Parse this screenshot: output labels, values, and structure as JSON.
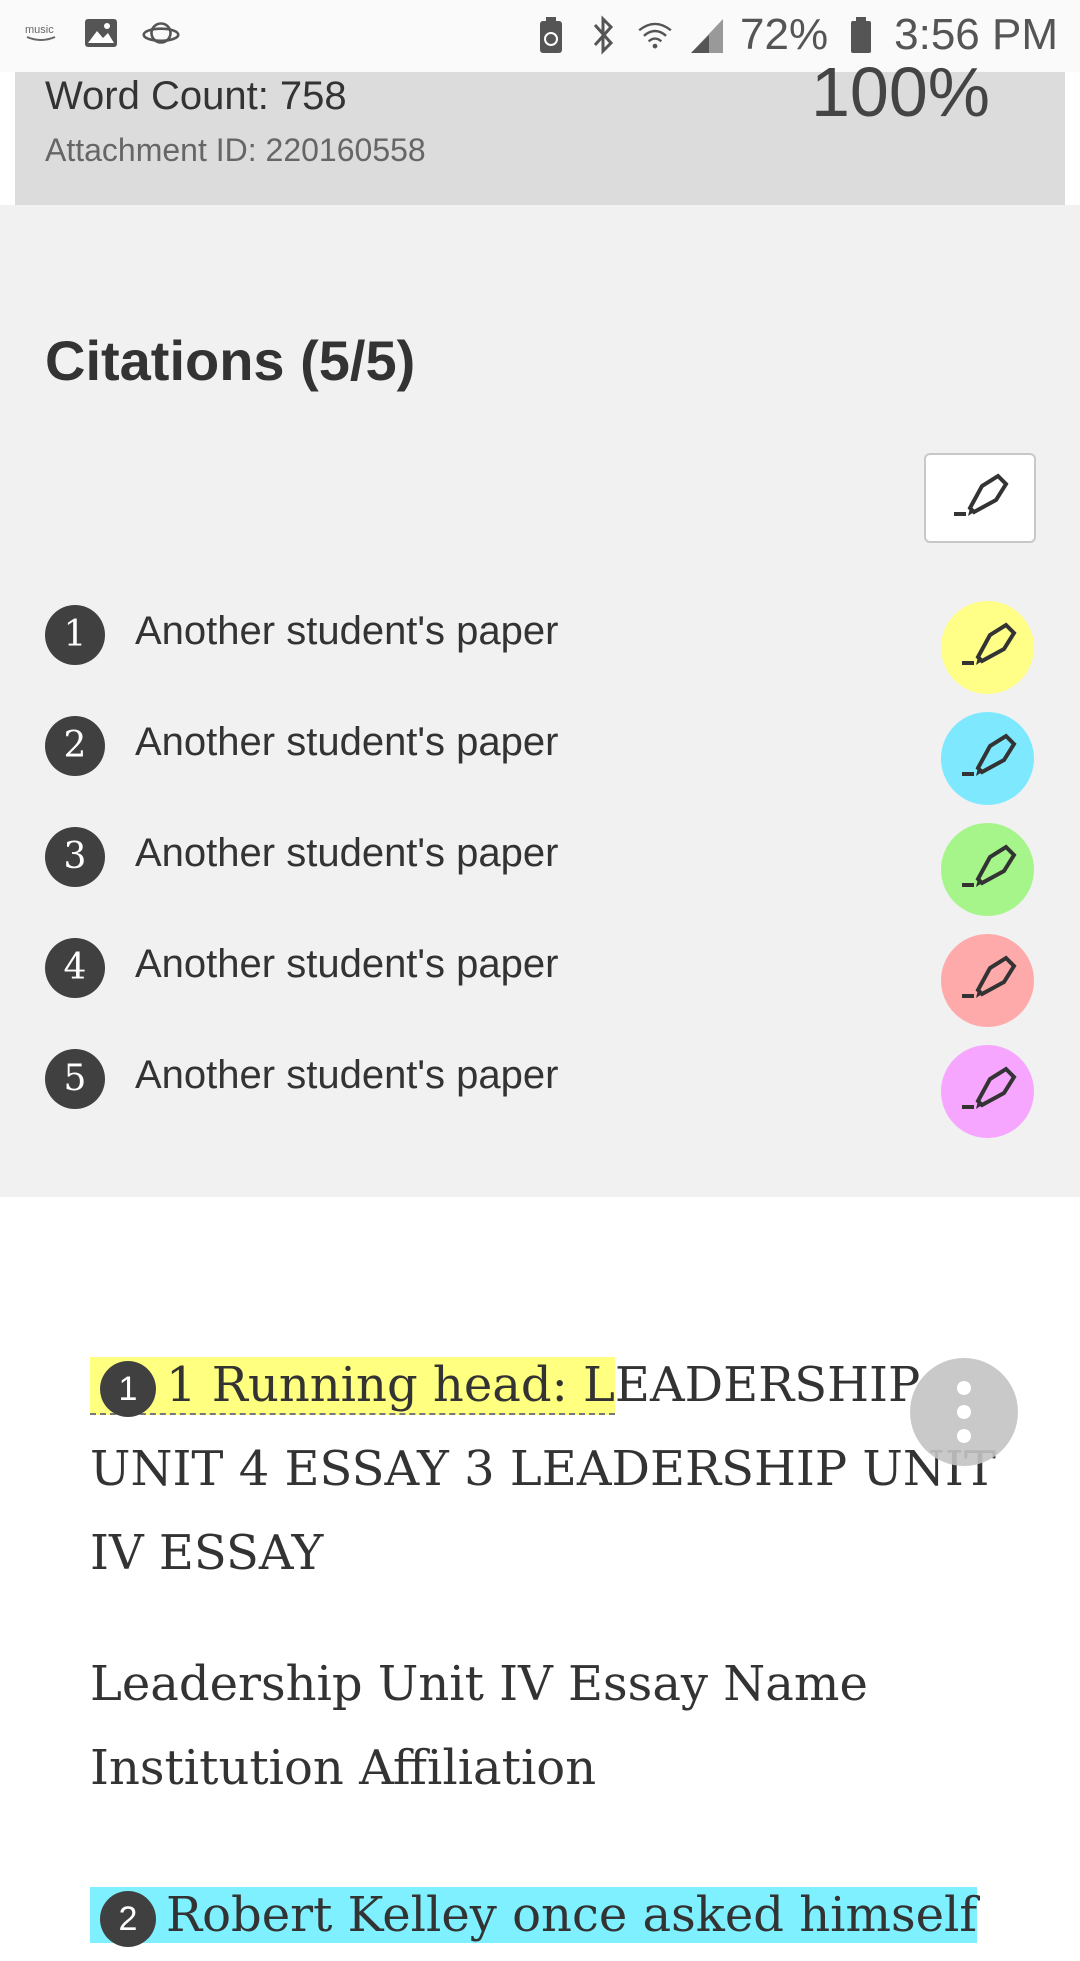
{
  "status_bar": {
    "left_icons": [
      "amazon-music-icon",
      "image-icon",
      "planet-browser-icon"
    ],
    "music_label": "music",
    "battery_percent": "72%",
    "time": "3:56 PM"
  },
  "summary": {
    "word_count": "Word Count: 758",
    "attachment_id": "Attachment ID: 220160558",
    "percent": "100%"
  },
  "citations": {
    "title": "Citations (5/5)",
    "items": [
      {
        "number": "1",
        "label": "Another student's paper",
        "color": "#ffff88"
      },
      {
        "number": "2",
        "label": "Another student's paper",
        "color": "#7ee8ff"
      },
      {
        "number": "3",
        "label": "Another student's paper",
        "color": "#a6f58a"
      },
      {
        "number": "4",
        "label": "Another student's paper",
        "color": "#ffaaaa"
      },
      {
        "number": "5",
        "label": "Another student's paper",
        "color": "#f6a6ff"
      }
    ]
  },
  "document": {
    "para1_marker": "1",
    "para1_highlight": "1 Running head: L",
    "para1_rest": "EADERSHIP UNIT 4 ESSAY 3 LEADERSHIP UNIT IV ESSAY",
    "para2": "Leadership Unit IV Essay Name Institution Affiliation",
    "para3_marker": "2",
    "para3_highlight": "Robert Kelley once asked himself"
  }
}
